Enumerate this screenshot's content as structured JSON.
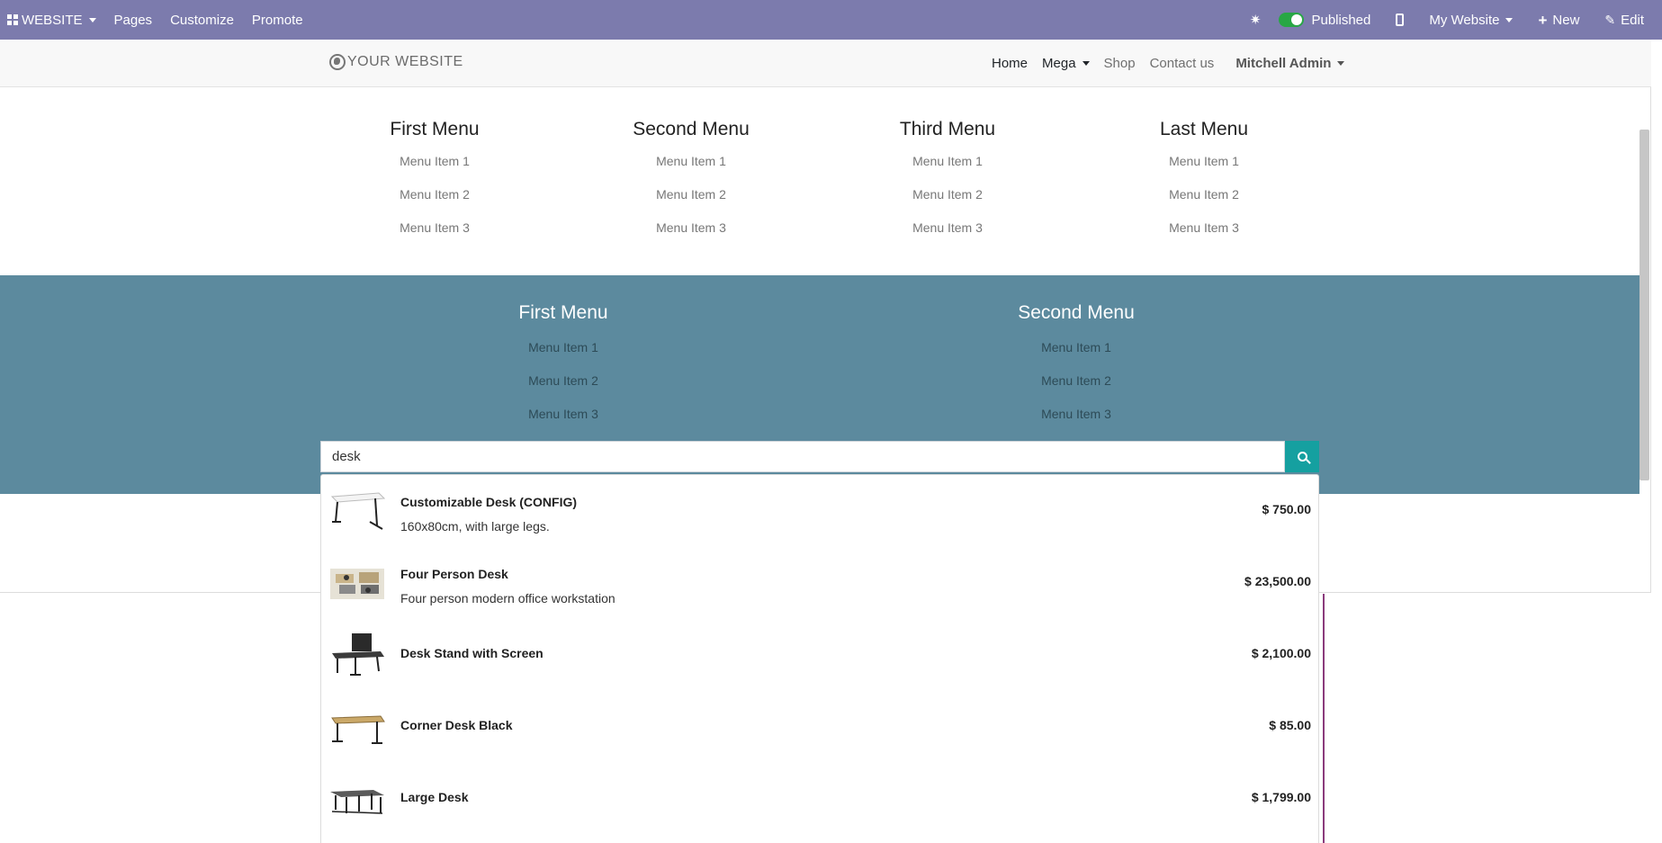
{
  "adminbar": {
    "website_label": "WEBSITE",
    "pages": "Pages",
    "customize": "Customize",
    "promote": "Promote",
    "published": "Published",
    "my_website": "My Website",
    "new": "New",
    "edit": "Edit"
  },
  "header": {
    "logo": "YOUR WEBSITE",
    "nav": {
      "home": "Home",
      "mega": "Mega",
      "shop": "Shop",
      "contact": "Contact us",
      "user": "Mitchell Admin"
    }
  },
  "mega_top": [
    {
      "title": "First Menu",
      "items": [
        "Menu Item 1",
        "Menu Item 2",
        "Menu Item 3"
      ]
    },
    {
      "title": "Second Menu",
      "items": [
        "Menu Item 1",
        "Menu Item 2",
        "Menu Item 3"
      ]
    },
    {
      "title": "Third Menu",
      "items": [
        "Menu Item 1",
        "Menu Item 2",
        "Menu Item 3"
      ]
    },
    {
      "title": "Last Menu",
      "items": [
        "Menu Item 1",
        "Menu Item 2",
        "Menu Item 3"
      ]
    }
  ],
  "mega_bottom": [
    {
      "title": "First Menu",
      "items": [
        "Menu Item 1",
        "Menu Item 2",
        "Menu Item 3"
      ]
    },
    {
      "title": "Second Menu",
      "items": [
        "Menu Item 1",
        "Menu Item 2",
        "Menu Item 3"
      ]
    }
  ],
  "search": {
    "value": "desk"
  },
  "results": [
    {
      "name": "Customizable Desk (CONFIG)",
      "desc": "160x80cm, with large legs.",
      "price": "$ 750.00"
    },
    {
      "name": "Four Person Desk",
      "desc": "Four person modern office workstation",
      "price": "$ 23,500.00"
    },
    {
      "name": "Desk Stand with Screen",
      "desc": "",
      "price": "$ 2,100.00"
    },
    {
      "name": "Corner Desk Black",
      "desc": "",
      "price": "$ 85.00"
    },
    {
      "name": "Large Desk",
      "desc": "",
      "price": "$ 1,799.00"
    }
  ]
}
